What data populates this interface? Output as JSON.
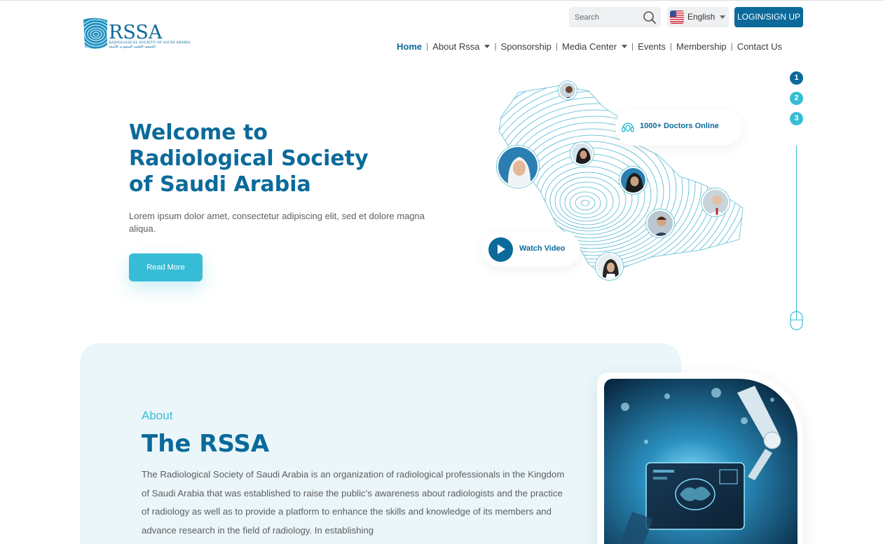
{
  "brand": {
    "name": "RSSA",
    "tagline_en": "RADIOLOGICAL SOCIETY OF SAUDI ARABIA",
    "tagline_ar": "الجمعية العلمية السعودية للأشعة",
    "accent": "#0b6a9a",
    "secondary": "#37bcd6"
  },
  "header": {
    "search_placeholder": "Search",
    "language": "English",
    "login_label": "LOGIN/SIGN UP"
  },
  "nav": {
    "items": [
      {
        "label": "Home",
        "active": true
      },
      {
        "label": "About Rssa",
        "dropdown": true
      },
      {
        "label": "Sponsorship"
      },
      {
        "label": "Media Center",
        "dropdown": true
      },
      {
        "label": "Events"
      },
      {
        "label": "Membership"
      },
      {
        "label": "Contact Us"
      }
    ]
  },
  "hero": {
    "title_lines": [
      "Welcome to",
      "Radiological Society",
      "of Saudi Arabia"
    ],
    "description": "Lorem ipsum dolor amet, consectetur adipiscing elit, sed et dolore magna aliqua.",
    "cta_label": "Read More",
    "doctors_online": "1000+ Doctors Online",
    "watch_video": "Watch Video"
  },
  "pager": {
    "slides": [
      "1",
      "2",
      "3"
    ],
    "active_index": 0
  },
  "about": {
    "eyebrow": "About",
    "title": "The RSSA",
    "body": "The Radiological Society of Saudi Arabia is an organization of radiological professionals in the Kingdom of Saudi Arabia that was established to raise the public’s awareness about radiologists and the practice of radiology as well as to provide a platform to enhance the skills and knowledge of its members and advance research in the field of radiology. In establishing"
  },
  "icons": {
    "search": "search-icon",
    "flag": "us-flag-icon",
    "headset": "headset-icon",
    "play": "play-icon",
    "mouse": "mouse-scroll-icon"
  }
}
